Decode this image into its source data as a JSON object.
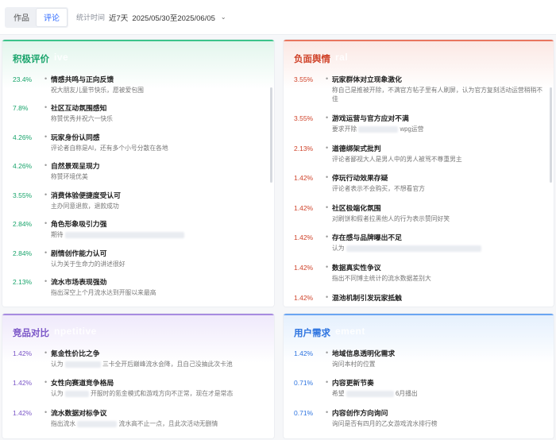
{
  "topbar": {
    "tabs": [
      {
        "label": "作品",
        "active": false
      },
      {
        "label": "评论",
        "active": true
      }
    ],
    "stat_label": "统计时间",
    "range_label": "近7天",
    "date_range": "2025/05/30至2025/06/05"
  },
  "colors": {
    "positive": "#18a46b",
    "negative": "#d0432a",
    "compare": "#7a55c7",
    "user": "#2d74e0"
  },
  "positive": {
    "title": "积极评价",
    "ghost": "ive",
    "items": [
      {
        "pct": "23.4%",
        "head": "情感共鸣与正向反馈",
        "desc": "祝大朋友儿童节快乐，愿被爱包围"
      },
      {
        "pct": "7.8%",
        "head": "社区互动氛围感知",
        "desc": "称赞优秀并祝六一快乐"
      },
      {
        "pct": "4.26%",
        "head": "玩家身份认同感",
        "desc": "评论者自称是AI，还有多个小号分散在各地"
      },
      {
        "pct": "4.26%",
        "head": "自然景观呈现力",
        "desc": "称赞环境优美"
      },
      {
        "pct": "3.55%",
        "head": "消费体验便捷度受认可",
        "desc": "主办同意退款，退款成功"
      },
      {
        "pct": "2.84%",
        "head": "角色形象吸引力强",
        "desc": "期待"
      },
      {
        "pct": "2.84%",
        "head": "剧情创作能力认可",
        "desc": "认为关于生命力的讲述很好"
      },
      {
        "pct": "2.13%",
        "head": "流水市场表现强劲",
        "desc": "指出深空上个月流水达到开服以来最高"
      }
    ]
  },
  "negative": {
    "title": "负面舆情",
    "ghost": "ral",
    "items": [
      {
        "pct": "3.55%",
        "head": "玩家群体对立现象激化",
        "desc": "称自己是推被开除，不满官方帖子里有人刷屏，认为官方复刻活动运营稍稍不佳"
      },
      {
        "pct": "3.55%",
        "head": "游戏运营与官方应对不满",
        "desc": "要求开除",
        "desc2": "wpg运营"
      },
      {
        "pct": "2.13%",
        "head": "道德绑架式批判",
        "desc": "评论者鄙视大人是男人中的男人被骂不尊重男主"
      },
      {
        "pct": "1.42%",
        "head": "停玩行动效果存疑",
        "desc": "评论者表示不会购买，不想看官方"
      },
      {
        "pct": "1.42%",
        "head": "社区极端化氛围",
        "desc": "对刷饼和假者拉黑他人的行为表示赞同好笑"
      },
      {
        "pct": "1.42%",
        "head": "存在感与品牌曝出不足",
        "desc": "认为"
      },
      {
        "pct": "1.42%",
        "head": "数据真实性争议",
        "desc": "指出不同博主统计的流水数据差别大"
      },
      {
        "pct": "1.42%",
        "head": "混池机制引发玩家抵触",
        "desc": ""
      }
    ]
  },
  "compare": {
    "title": "竞品对比",
    "ghost": "npetitive",
    "items": [
      {
        "pct": "1.42%",
        "head": "氪金性价比之争",
        "desc": "认为",
        "desc2": "三卡全开后巅峰流水会降，且自己没抽此次卡池"
      },
      {
        "pct": "1.42%",
        "head": "女性向赛道竞争格局",
        "desc": "认为",
        "desc2": "开服时的氪金模式和游戏方向不正常，现在才是常态"
      },
      {
        "pct": "1.42%",
        "head": "流水数据对标争议",
        "desc": "指出流水",
        "desc2": "流水高不止一点，且此次活动无删情"
      }
    ]
  },
  "user": {
    "title": "用户需求",
    "ghost": "ement",
    "items": [
      {
        "pct": "1.42%",
        "head": "地域信息透明化需求",
        "desc": "询问本村的位置"
      },
      {
        "pct": "0.71%",
        "head": "内容更新节奏",
        "desc": "希望",
        "desc2": "6月播出"
      },
      {
        "pct": "0.71%",
        "head": "内容创作方向询问",
        "desc": "询问是否有四月的乙女游戏流水排行榜"
      }
    ]
  }
}
